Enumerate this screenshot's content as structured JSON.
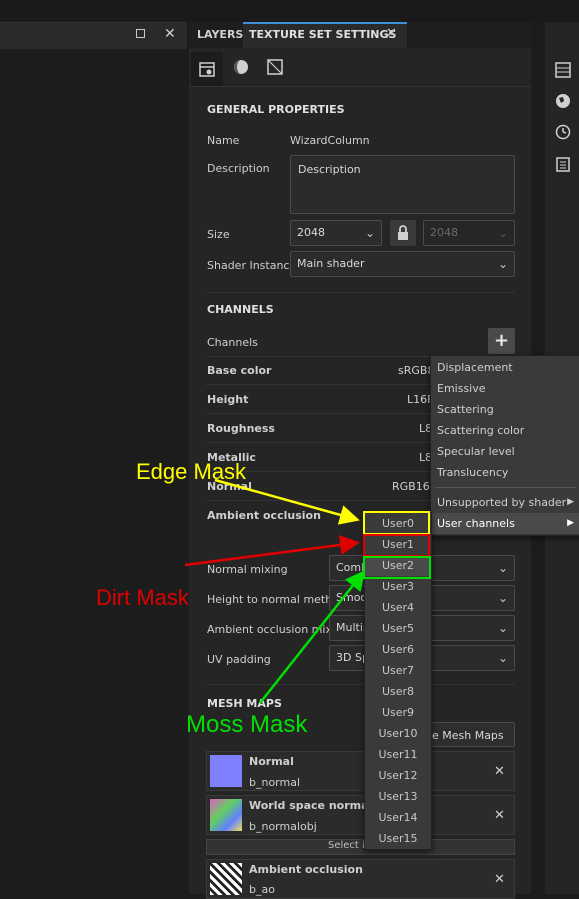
{
  "tabs": {
    "layers": "LAYERS",
    "texture_set_settings": "TEXTURE SET SETTINGS"
  },
  "general": {
    "header": "GENERAL PROPERTIES",
    "name_label": "Name",
    "name_value": "WizardColumn",
    "description_label": "Description",
    "description_value": "Description",
    "size_label": "Size",
    "size_value": "2048",
    "size_value_disabled": "2048",
    "shader_label": "Shader Instance",
    "shader_value": "Main shader"
  },
  "channels": {
    "header": "CHANNELS",
    "channels_label": "Channels",
    "rows": [
      {
        "name": "Base color",
        "format": "sRGB8"
      },
      {
        "name": "Height",
        "format": "L16F"
      },
      {
        "name": "Roughness",
        "format": "L8"
      },
      {
        "name": "Metallic",
        "format": "L8"
      },
      {
        "name": "Normal",
        "format": "RGB16F"
      },
      {
        "name": "Ambient occlusion",
        "format": ""
      }
    ]
  },
  "settings": {
    "normal_mixing_label": "Normal mixing",
    "normal_mixing_value": "Combi",
    "height_to_normal_label": "Height to normal method",
    "height_to_normal_value": "Smoo",
    "ao_mixing_label": "Ambient occlusion mixing",
    "ao_mixing_value": "Multip",
    "uv_padding_label": "UV padding",
    "uv_padding_value": "3D Sp"
  },
  "mesh_maps": {
    "header": "MESH MAPS",
    "bake_button": "ke Mesh Maps",
    "select_id_map": "Select id map",
    "maps": [
      {
        "title": "Normal",
        "file": "b_normal"
      },
      {
        "title": "World space normal",
        "file": "b_normalobj"
      },
      {
        "title": "Ambient occlusion",
        "file": "b_ao"
      }
    ]
  },
  "add_menu": {
    "items": [
      "Displacement",
      "Emissive",
      "Scattering",
      "Scattering color",
      "Specular level",
      "Translucency"
    ],
    "unsupported": "Unsupported by shader",
    "user_channels": "User channels"
  },
  "user_channels": [
    "User0",
    "User1",
    "User2",
    "User3",
    "User4",
    "User5",
    "User6",
    "User7",
    "User8",
    "User9",
    "User10",
    "User11",
    "User12",
    "User13",
    "User14",
    "User15"
  ],
  "annotations": {
    "edge": "Edge Mask",
    "dirt": "Dirt Mask",
    "moss": "Moss Mask",
    "edge_color": "#ffff00",
    "dirt_color": "#e00000",
    "moss_color": "#00e000"
  },
  "colors": {
    "accent": "#3d8fd6",
    "panel": "#252525",
    "menu": "#3a3a3a"
  }
}
